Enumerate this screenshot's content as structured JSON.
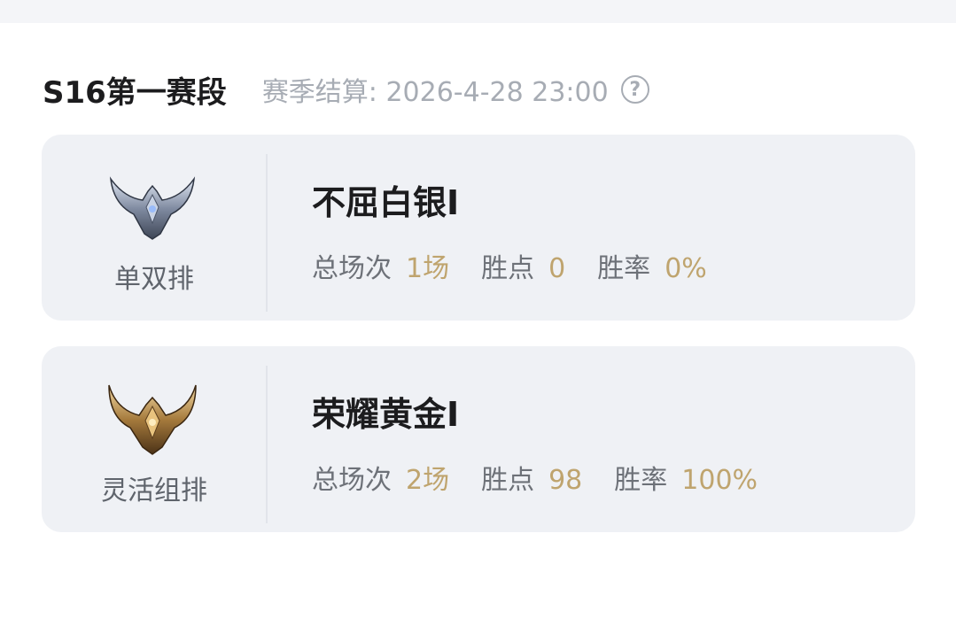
{
  "season": {
    "title": "S16第一赛段",
    "settlement": "赛季结算: 2026-4-28 23:00",
    "help_icon": "question-circle-icon"
  },
  "colors": {
    "value_gold": "#bfa46e",
    "card_bg": "#eff1f5",
    "muted_text": "#a7acb4"
  },
  "ranks": [
    {
      "queue": "单双排",
      "rank_name": "不屈白银I",
      "emblem_icon": "silver-rank-emblem-icon",
      "stats": {
        "games_label": "总场次",
        "games_value": "1场",
        "lp_label": "胜点",
        "lp_value": "0",
        "winrate_label": "胜率",
        "winrate_value": "0%"
      }
    },
    {
      "queue": "灵活组排",
      "rank_name": "荣耀黄金I",
      "emblem_icon": "gold-rank-emblem-icon",
      "stats": {
        "games_label": "总场次",
        "games_value": "2场",
        "lp_label": "胜点",
        "lp_value": "98",
        "winrate_label": "胜率",
        "winrate_value": "100%"
      }
    }
  ]
}
